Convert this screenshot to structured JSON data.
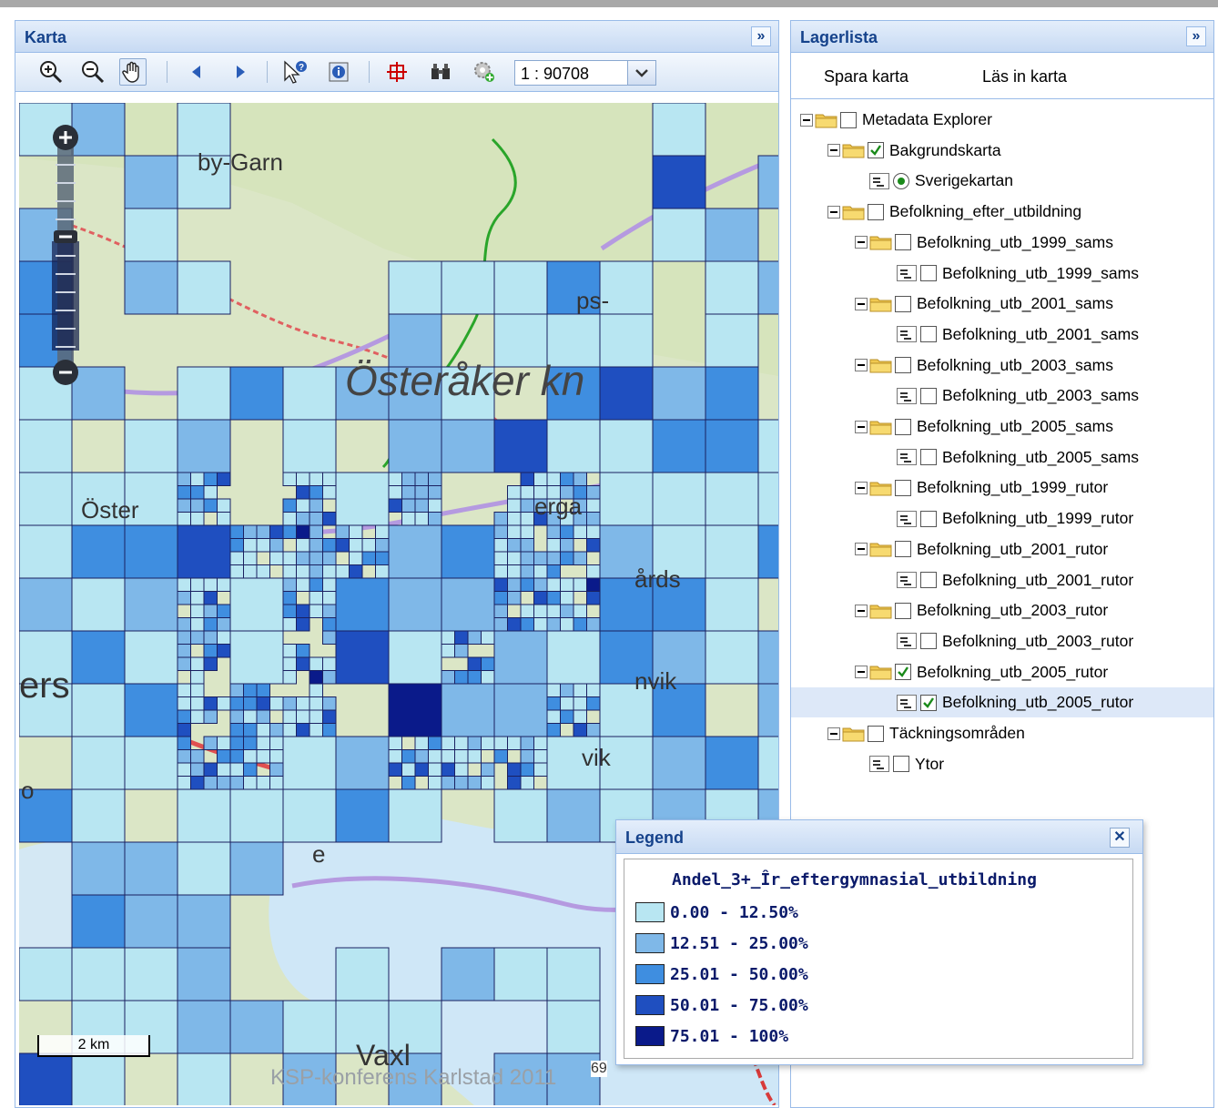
{
  "map_panel": {
    "title": "Karta",
    "collapse_glyph": "»",
    "toolbar": {
      "icons": [
        "zoom-in-icon",
        "zoom-out-icon",
        "pan-hand-icon",
        "back-arrow-icon",
        "forward-arrow-icon",
        "query-pointer-icon",
        "identify-info-icon",
        "full-extent-icon",
        "binoculars-icon",
        "add-layer-gear-icon"
      ],
      "scale_value": "1 : 90708"
    },
    "map": {
      "place_labels": [
        "by-Garn",
        "ps-",
        "Österåker kn",
        "erga",
        "Öster",
        "årds",
        "nvik",
        "ers",
        "vik",
        "o",
        "e",
        "Vaxl",
        "69"
      ],
      "scalebar_label": "2 km"
    }
  },
  "layer_panel": {
    "title": "Lagerlista",
    "collapse_glyph": "»",
    "buttons": {
      "save": "Spara karta",
      "load": "Läs in karta"
    },
    "tree": [
      {
        "label": "Metadata Explorer",
        "level": 0,
        "kind": "folder",
        "checked": false
      },
      {
        "label": "Bakgrundskarta",
        "level": 1,
        "kind": "folder",
        "checked": true
      },
      {
        "label": "Sverigekartan",
        "level": 2,
        "kind": "radio",
        "checked": true
      },
      {
        "label": "Befolkning_efter_utbildning",
        "level": 1,
        "kind": "folder",
        "checked": false
      },
      {
        "label": "Befolkning_utb_1999_sams",
        "level": 2,
        "kind": "folder",
        "checked": false
      },
      {
        "label": "Befolkning_utb_1999_sams",
        "level": 3,
        "kind": "leaf",
        "checked": false
      },
      {
        "label": "Befolkning_utb_2001_sams",
        "level": 2,
        "kind": "folder",
        "checked": false
      },
      {
        "label": "Befolkning_utb_2001_sams",
        "level": 3,
        "kind": "leaf",
        "checked": false
      },
      {
        "label": "Befolkning_utb_2003_sams",
        "level": 2,
        "kind": "folder",
        "checked": false
      },
      {
        "label": "Befolkning_utb_2003_sams",
        "level": 3,
        "kind": "leaf",
        "checked": false
      },
      {
        "label": "Befolkning_utb_2005_sams",
        "level": 2,
        "kind": "folder",
        "checked": false
      },
      {
        "label": "Befolkning_utb_2005_sams",
        "level": 3,
        "kind": "leaf",
        "checked": false
      },
      {
        "label": "Befolkning_utb_1999_rutor",
        "level": 2,
        "kind": "folder",
        "checked": false
      },
      {
        "label": "Befolkning_utb_1999_rutor",
        "level": 3,
        "kind": "leaf",
        "checked": false
      },
      {
        "label": "Befolkning_utb_2001_rutor",
        "level": 2,
        "kind": "folder",
        "checked": false
      },
      {
        "label": "Befolkning_utb_2001_rutor",
        "level": 3,
        "kind": "leaf",
        "checked": false
      },
      {
        "label": "Befolkning_utb_2003_rutor",
        "level": 2,
        "kind": "folder",
        "checked": false
      },
      {
        "label": "Befolkning_utb_2003_rutor",
        "level": 3,
        "kind": "leaf",
        "checked": false
      },
      {
        "label": "Befolkning_utb_2005_rutor",
        "level": 2,
        "kind": "folder",
        "checked": true
      },
      {
        "label": "Befolkning_utb_2005_rutor",
        "level": 3,
        "kind": "leaf",
        "checked": true,
        "selected": true
      },
      {
        "label": "Täckningsområden",
        "level": 1,
        "kind": "folder",
        "checked": false
      },
      {
        "label": "Ytor",
        "level": 2,
        "kind": "leaf",
        "checked": false
      }
    ]
  },
  "legend": {
    "title": "Legend",
    "close_glyph": "✕",
    "variable": "Andel_3+_Îr_eftergymnasial_utbildning",
    "classes": [
      {
        "label": "0.00 - 12.50%",
        "color": "#b8e6f2"
      },
      {
        "label": "12.51 - 25.00%",
        "color": "#7fb8e8"
      },
      {
        "label": "25.01 - 50.00%",
        "color": "#3f8ee0"
      },
      {
        "label": "50.01 - 75.00%",
        "color": "#1f4fc0"
      },
      {
        "label": "75.01 - 100%",
        "color": "#0a1a8a"
      }
    ]
  },
  "footer": {
    "watermark": "KSP-konferens Karlstad 2011"
  }
}
